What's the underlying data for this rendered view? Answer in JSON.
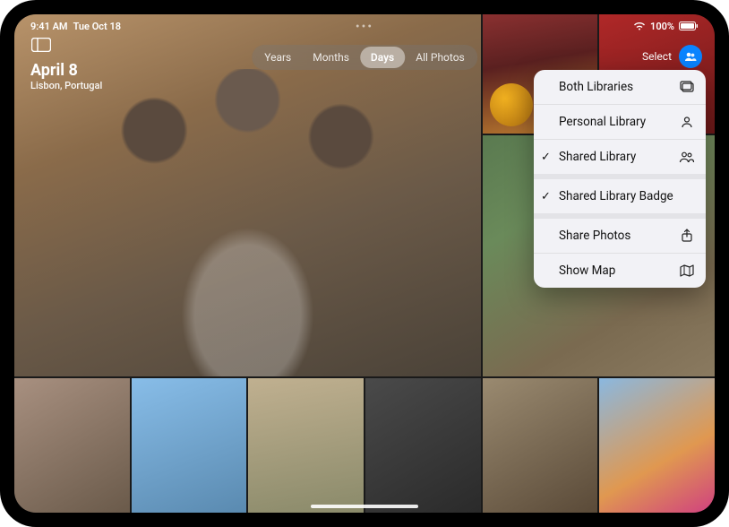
{
  "status": {
    "time": "9:41 AM",
    "date": "Tue Oct 18",
    "battery_pct": "100%"
  },
  "header": {
    "date_title": "April 8",
    "location": "Lisbon, Portugal"
  },
  "segmented": {
    "items": [
      "Years",
      "Months",
      "Days",
      "All Photos"
    ],
    "active_index": 2
  },
  "top_right": {
    "select_label": "Select"
  },
  "menu": {
    "items": [
      {
        "label": "Both Libraries",
        "icon": "stacked-photos-icon",
        "checked": false,
        "sep": false
      },
      {
        "label": "Personal Library",
        "icon": "person-icon",
        "checked": false,
        "sep": false
      },
      {
        "label": "Shared Library",
        "icon": "people-icon",
        "checked": true,
        "sep": false
      },
      {
        "label": "Shared Library Badge",
        "icon": "",
        "checked": true,
        "sep": true
      },
      {
        "label": "Share Photos",
        "icon": "share-icon",
        "checked": false,
        "sep": true
      },
      {
        "label": "Show Map",
        "icon": "map-icon",
        "checked": false,
        "sep": false
      }
    ]
  }
}
